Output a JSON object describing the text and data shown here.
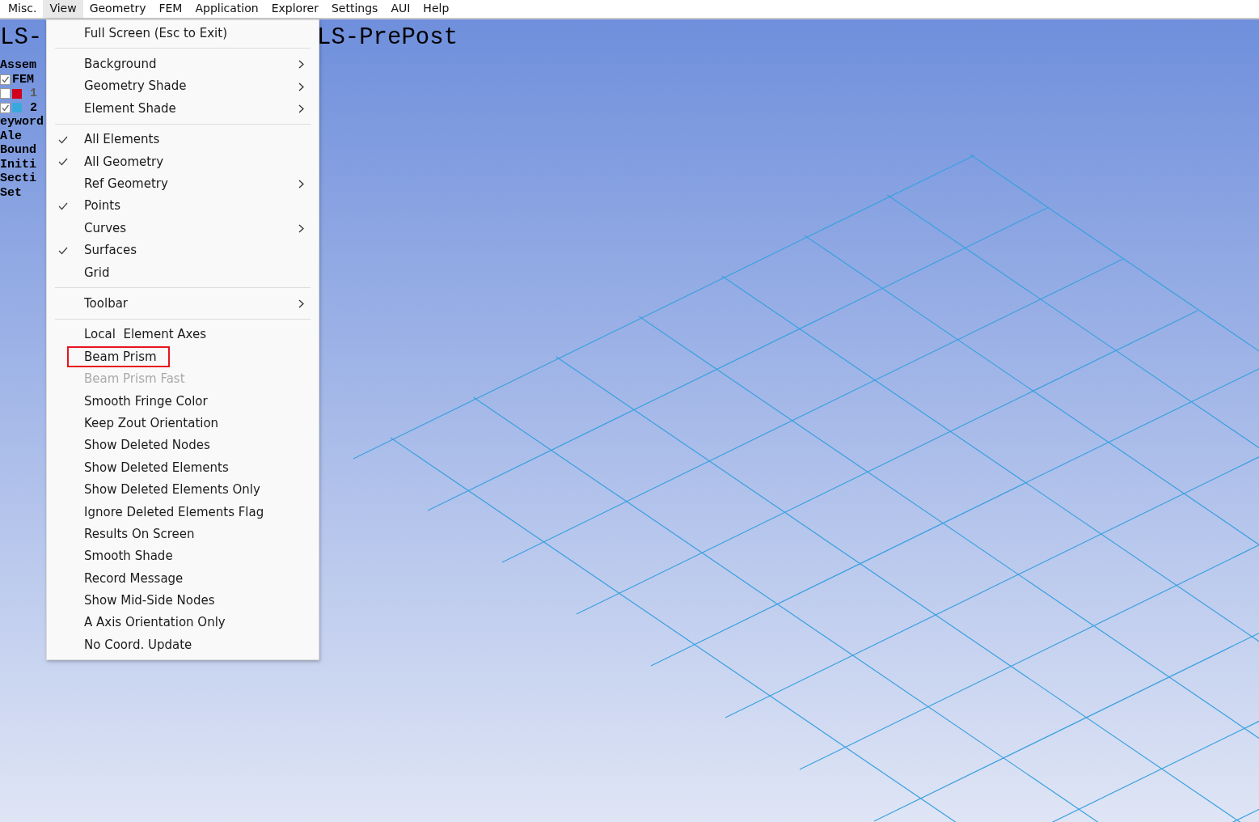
{
  "menubar": [
    {
      "label": "Misc.",
      "selected": false
    },
    {
      "label": "View",
      "selected": true
    },
    {
      "label": "Geometry",
      "selected": false
    },
    {
      "label": "FEM",
      "selected": false
    },
    {
      "label": "Application",
      "selected": false
    },
    {
      "label": "Explorer",
      "selected": false
    },
    {
      "label": "Settings",
      "selected": false
    },
    {
      "label": "AUI",
      "selected": false
    },
    {
      "label": "Help",
      "selected": false
    }
  ],
  "viewport": {
    "title_left": "LS-",
    "title_right": "LS-PrePost",
    "tree": [
      {
        "kind": "text",
        "label": "Assem"
      },
      {
        "kind": "part",
        "label": "FEM",
        "checked": true
      },
      {
        "kind": "part-row",
        "label": "1",
        "checked": false,
        "color": "#d0021b"
      },
      {
        "kind": "part-row",
        "label": "2",
        "checked": true,
        "color": "#3aa8dc"
      },
      {
        "kind": "text",
        "label": "eyword"
      },
      {
        "kind": "text",
        "label": "Ale"
      },
      {
        "kind": "text",
        "label": "Bound"
      },
      {
        "kind": "text",
        "label": "Initi"
      },
      {
        "kind": "text",
        "label": "Secti"
      },
      {
        "kind": "text",
        "label": "Set"
      }
    ]
  },
  "menu": [
    {
      "kind": "item",
      "label": "Full Screen (Esc to Exit)",
      "checked": false,
      "submenu": false,
      "disabled": false,
      "highlighted": false
    },
    {
      "kind": "separator"
    },
    {
      "kind": "item",
      "label": "Background",
      "checked": false,
      "submenu": true,
      "disabled": false,
      "highlighted": false
    },
    {
      "kind": "item",
      "label": "Geometry Shade",
      "checked": false,
      "submenu": true,
      "disabled": false,
      "highlighted": false
    },
    {
      "kind": "item",
      "label": "Element Shade",
      "checked": false,
      "submenu": true,
      "disabled": false,
      "highlighted": false
    },
    {
      "kind": "separator"
    },
    {
      "kind": "item",
      "label": "All Elements",
      "checked": true,
      "submenu": false,
      "disabled": false,
      "highlighted": false
    },
    {
      "kind": "item",
      "label": "All Geometry",
      "checked": true,
      "submenu": false,
      "disabled": false,
      "highlighted": false
    },
    {
      "kind": "item",
      "label": "Ref Geometry",
      "checked": false,
      "submenu": true,
      "disabled": false,
      "highlighted": false
    },
    {
      "kind": "item",
      "label": "Points",
      "checked": true,
      "submenu": false,
      "disabled": false,
      "highlighted": false
    },
    {
      "kind": "item",
      "label": "Curves",
      "checked": false,
      "submenu": true,
      "disabled": false,
      "highlighted": false
    },
    {
      "kind": "item",
      "label": "Surfaces",
      "checked": true,
      "submenu": false,
      "disabled": false,
      "highlighted": false
    },
    {
      "kind": "item",
      "label": "Grid",
      "checked": false,
      "submenu": false,
      "disabled": false,
      "highlighted": false
    },
    {
      "kind": "separator"
    },
    {
      "kind": "item",
      "label": "Toolbar",
      "checked": false,
      "submenu": true,
      "disabled": false,
      "highlighted": false
    },
    {
      "kind": "separator"
    },
    {
      "kind": "item",
      "label": "Local  Element Axes",
      "checked": false,
      "submenu": false,
      "disabled": false,
      "highlighted": false
    },
    {
      "kind": "item",
      "label": "Beam Prism",
      "checked": false,
      "submenu": false,
      "disabled": false,
      "highlighted": true
    },
    {
      "kind": "item",
      "label": "Beam Prism Fast",
      "checked": false,
      "submenu": false,
      "disabled": true,
      "highlighted": false
    },
    {
      "kind": "item",
      "label": "Smooth Fringe Color",
      "checked": false,
      "submenu": false,
      "disabled": false,
      "highlighted": false
    },
    {
      "kind": "item",
      "label": "Keep Zout Orientation",
      "checked": false,
      "submenu": false,
      "disabled": false,
      "highlighted": false
    },
    {
      "kind": "item",
      "label": "Show Deleted Nodes",
      "checked": false,
      "submenu": false,
      "disabled": false,
      "highlighted": false
    },
    {
      "kind": "item",
      "label": "Show Deleted Elements",
      "checked": false,
      "submenu": false,
      "disabled": false,
      "highlighted": false
    },
    {
      "kind": "item",
      "label": "Show Deleted Elements Only",
      "checked": false,
      "submenu": false,
      "disabled": false,
      "highlighted": false
    },
    {
      "kind": "item",
      "label": "Ignore Deleted Elements Flag",
      "checked": false,
      "submenu": false,
      "disabled": false,
      "highlighted": false
    },
    {
      "kind": "item",
      "label": "Results On Screen",
      "checked": false,
      "submenu": false,
      "disabled": false,
      "highlighted": false
    },
    {
      "kind": "item",
      "label": "Smooth Shade",
      "checked": false,
      "submenu": false,
      "disabled": false,
      "highlighted": false
    },
    {
      "kind": "item",
      "label": "Record Message",
      "checked": false,
      "submenu": false,
      "disabled": false,
      "highlighted": false
    },
    {
      "kind": "item",
      "label": "Show Mid-Side Nodes",
      "checked": false,
      "submenu": false,
      "disabled": false,
      "highlighted": false
    },
    {
      "kind": "item",
      "label": "A Axis Orientation Only",
      "checked": false,
      "submenu": false,
      "disabled": false,
      "highlighted": false
    },
    {
      "kind": "item",
      "label": "No Coord. Update",
      "checked": false,
      "submenu": false,
      "disabled": false,
      "highlighted": false
    }
  ]
}
